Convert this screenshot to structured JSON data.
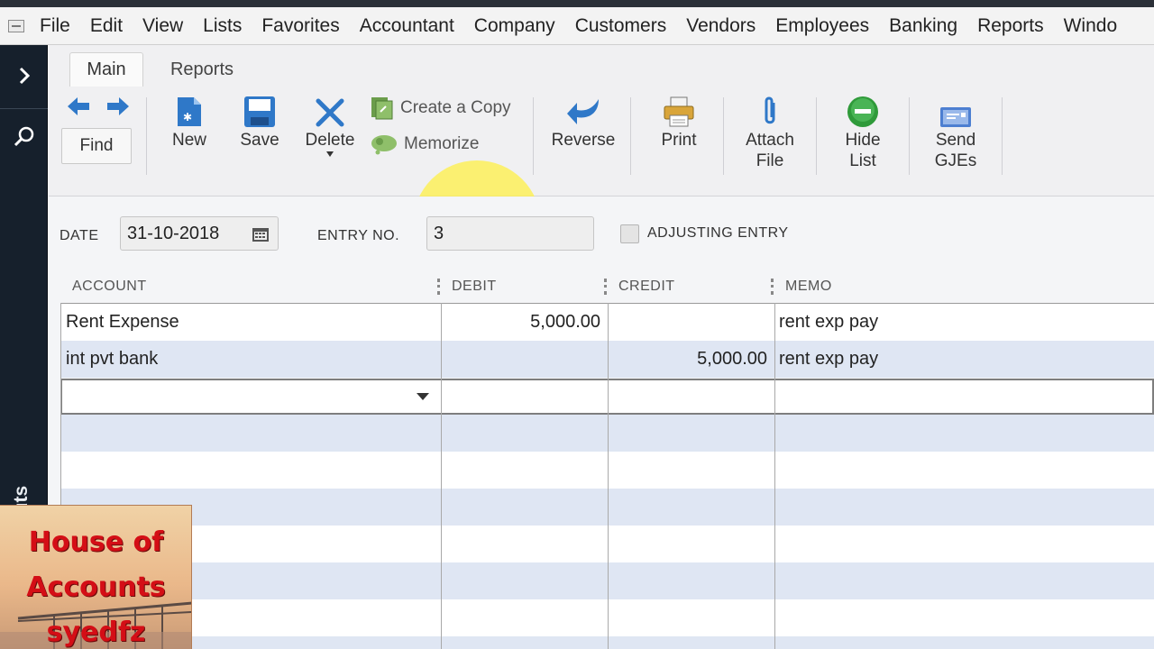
{
  "menu": {
    "items": [
      "File",
      "Edit",
      "View",
      "Lists",
      "Favorites",
      "Accountant",
      "Company",
      "Customers",
      "Vendors",
      "Employees",
      "Banking",
      "Reports",
      "Windo"
    ]
  },
  "sidebar": {
    "shortcuts_label": "ortcuts"
  },
  "ribbon": {
    "tabs": [
      "Main",
      "Reports"
    ],
    "find_label": "Find",
    "new_label": "New",
    "save_label": "Save",
    "delete_label": "Delete",
    "create_copy_label": "Create a Copy",
    "memorize_label": "Memorize",
    "reverse_label": "Reverse",
    "print_label": "Print",
    "attach_label_1": "Attach",
    "attach_label_2": "File",
    "hide_label_1": "Hide",
    "hide_label_2": "List",
    "send_label_1": "Send",
    "send_label_2": "GJEs"
  },
  "form": {
    "date_label": "DATE",
    "date_value": "31-10-2018",
    "entry_label": "ENTRY NO.",
    "entry_value": "3",
    "adjusting_label": "ADJUSTING ENTRY"
  },
  "grid": {
    "columns": [
      "ACCOUNT",
      "DEBIT",
      "CREDIT",
      "MEMO"
    ],
    "rows": [
      {
        "account": "Rent Expense",
        "debit": "5,000.00",
        "credit": "",
        "memo": "rent exp pay"
      },
      {
        "account": "int pvt bank",
        "debit": "",
        "credit": "5,000.00",
        "memo": "rent exp pay"
      }
    ]
  },
  "watermark": {
    "line1": "House of",
    "line2": "Accounts",
    "line3": "syedfz"
  },
  "colors": {
    "sidebar": "#16202c",
    "row_alt": "#dfe6f3",
    "highlight": "#fff046",
    "icon_blue": "#2f78c8",
    "icon_green": "#2f9a3a",
    "watermark_text": "#d40e16"
  }
}
